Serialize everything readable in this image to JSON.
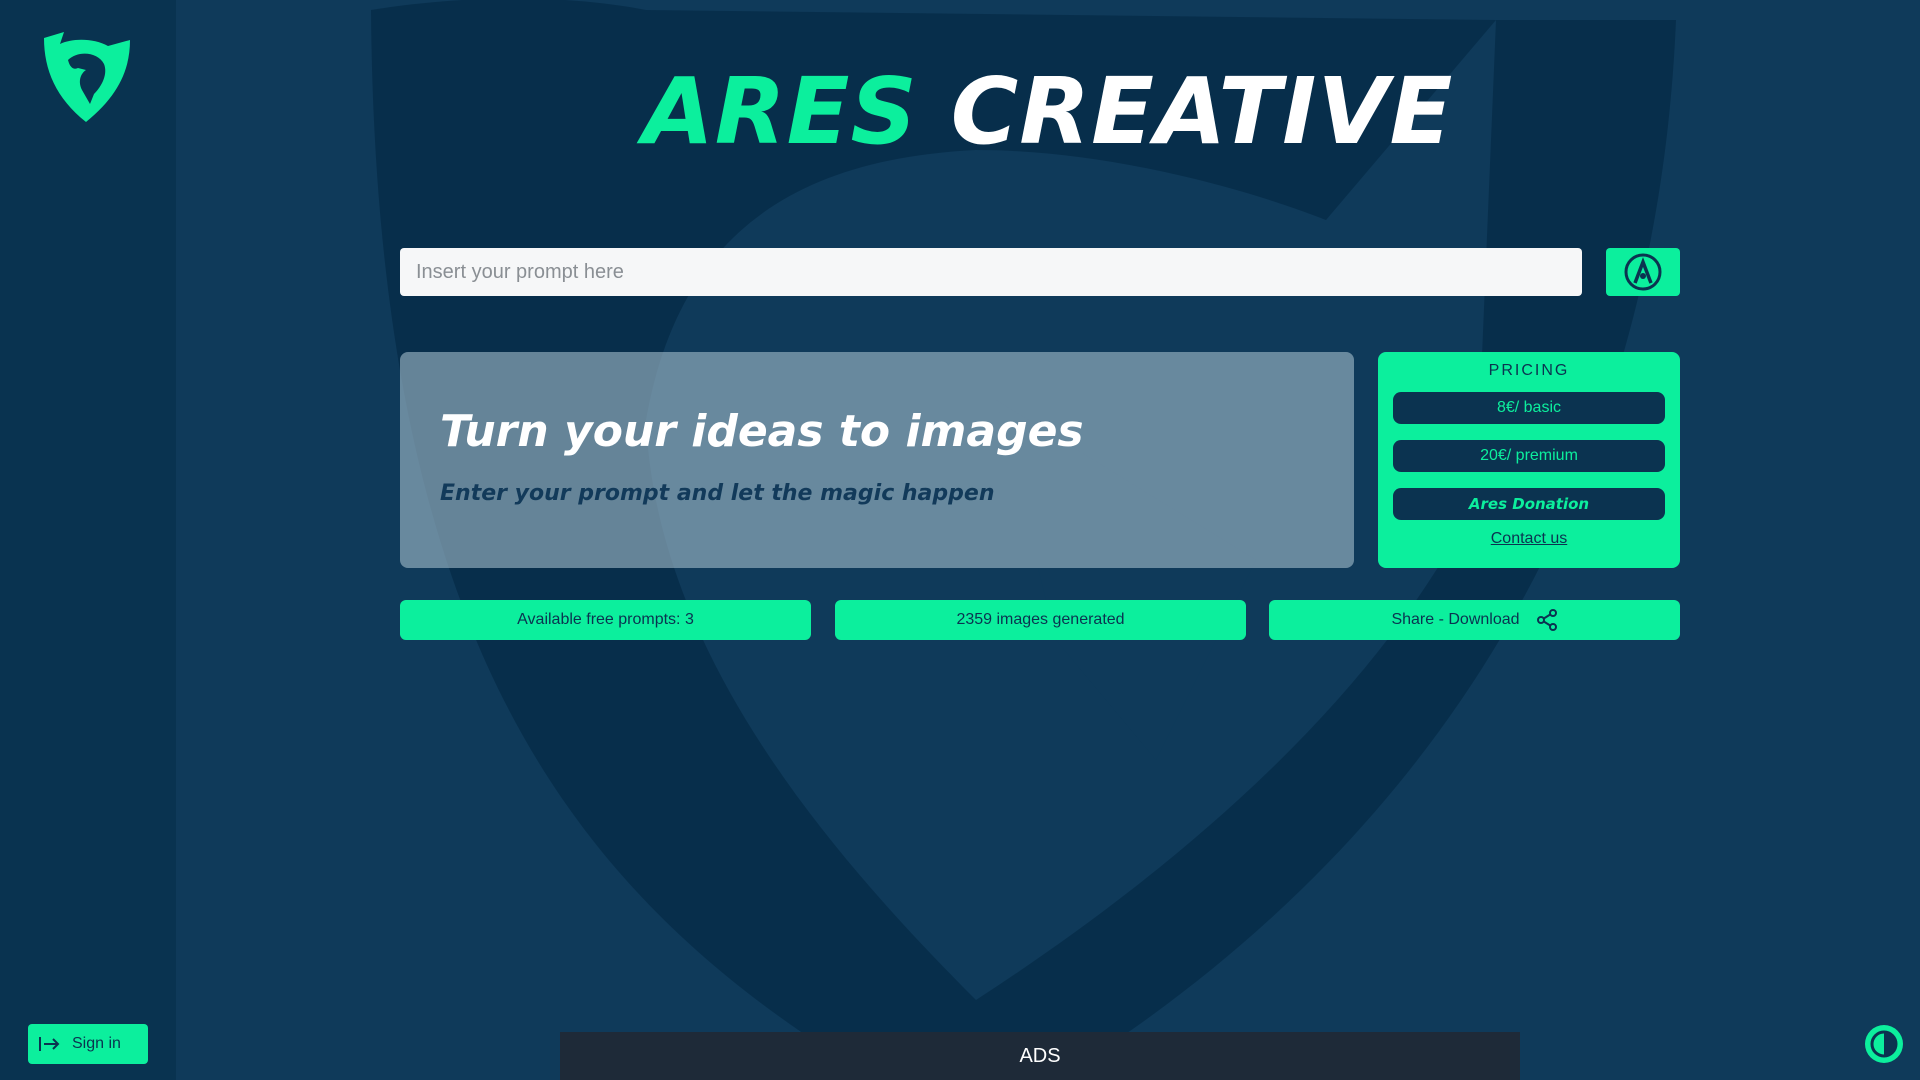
{
  "app": {
    "title_part1": "ARES",
    "title_part2": "CREATIVE"
  },
  "search": {
    "placeholder": "Insert your prompt here",
    "submit_icon": "ares-a-circle-icon"
  },
  "hero": {
    "heading": "Turn your ideas to images",
    "subheading": "Enter your prompt and let the magic happen"
  },
  "pricing": {
    "title": "PRICING",
    "basic": "8€/ basic",
    "premium": "20€/ premium",
    "donation": "Ares Donation",
    "contact": "Contact us"
  },
  "stats": {
    "free_prompts": "Available free prompts: 3",
    "images_generated": "2359 images generated",
    "share": "Share - Download",
    "share_icon": "share-icon"
  },
  "sidebar": {
    "logo_icon": "ares-shield-logo",
    "signin_label": "Sign in",
    "signin_icon": "sign-in-icon"
  },
  "footer": {
    "ads_label": "ADS",
    "theme_icon": "theme-toggle-icon"
  },
  "colors": {
    "accent": "#0cef9d",
    "background": "#0f3a5a",
    "sidebar": "#093350",
    "dark_text": "#0b3350"
  }
}
